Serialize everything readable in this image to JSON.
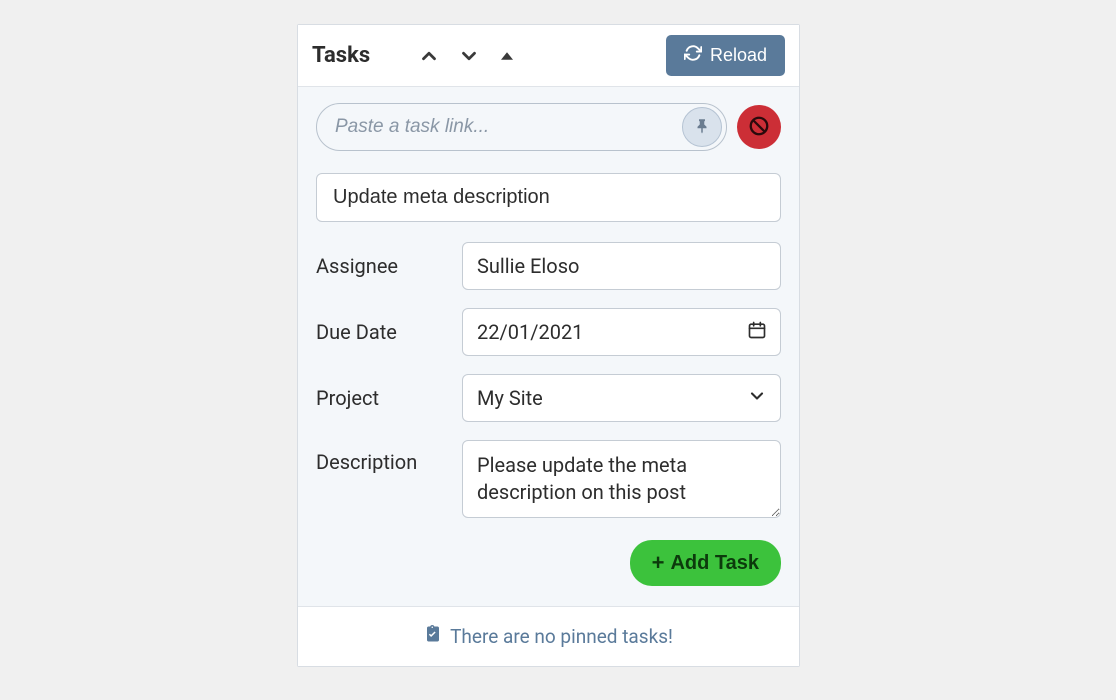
{
  "panel": {
    "title": "Tasks",
    "reload_label": "Reload"
  },
  "link_input": {
    "placeholder": "Paste a task link..."
  },
  "form": {
    "title_value": "Update meta description",
    "assignee": {
      "label": "Assignee",
      "value": "Sullie Eloso"
    },
    "due_date": {
      "label": "Due Date",
      "value": "22/01/2021"
    },
    "project": {
      "label": "Project",
      "value": "My Site"
    },
    "description": {
      "label": "Description",
      "value": "Please update the meta description on this post"
    },
    "add_task_label": "Add Task"
  },
  "footer": {
    "empty_pinned_message": "There are no pinned tasks!"
  }
}
